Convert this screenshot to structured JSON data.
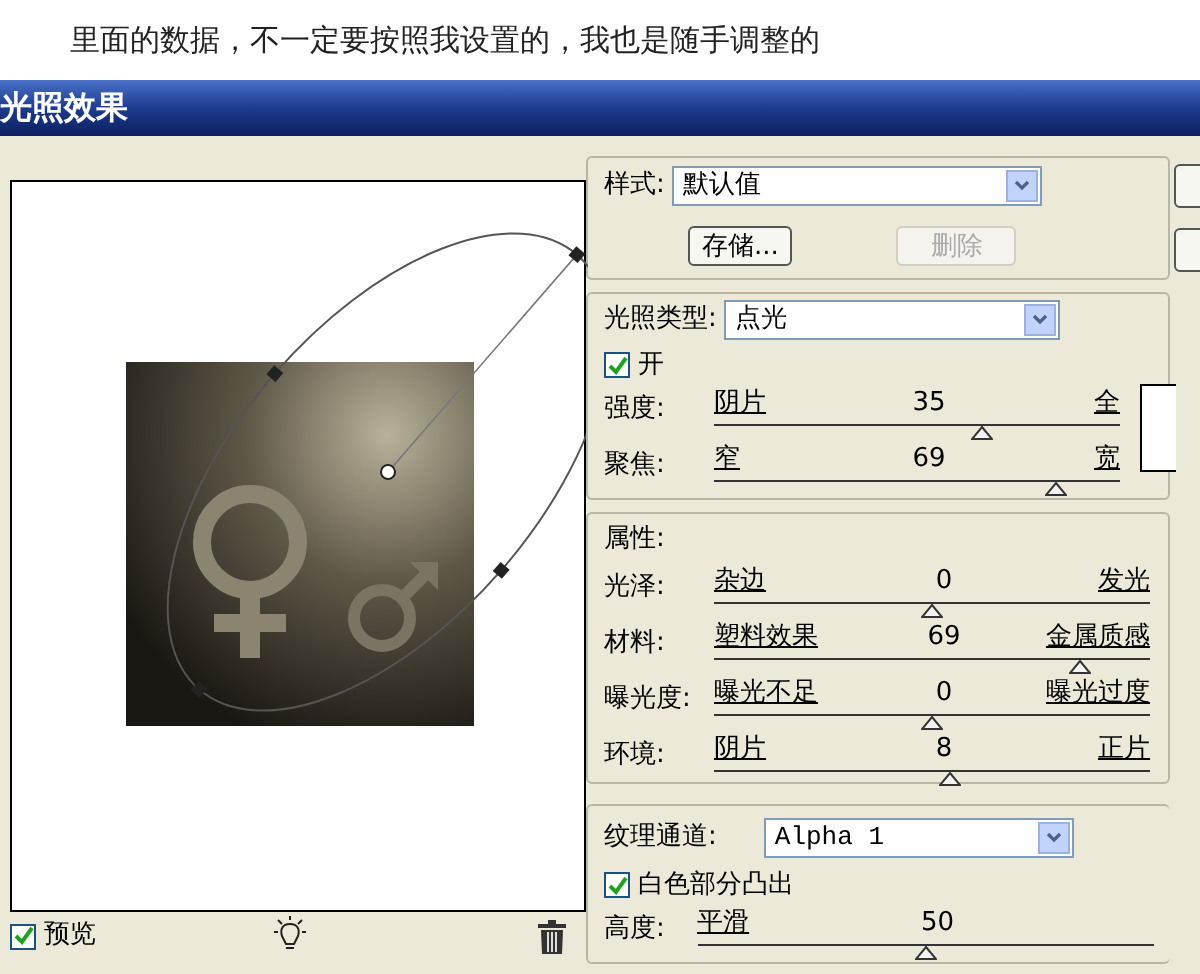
{
  "caption": "里面的数据，不一定要按照我设置的，我也是随手调整的",
  "window": {
    "title": "光照效果"
  },
  "style": {
    "label": "样式:",
    "value": "默认值"
  },
  "buttons": [
    {
      "label": "存储...",
      "disabled": false
    },
    {
      "label": "删除",
      "disabled": true
    }
  ],
  "light_type": {
    "label": "光照类型:",
    "value": "点光"
  },
  "light_on": {
    "label": "开",
    "checked": true
  },
  "light_sliders": [
    {
      "label": "强度:",
      "min": "阴片",
      "value": "35",
      "max": "全",
      "level": 0.66
    },
    {
      "label": "聚焦:",
      "min": "窄",
      "value": "69",
      "max": "宽",
      "level": 0.84
    }
  ],
  "properties": {
    "title": "属性:",
    "sliders": [
      {
        "label": "光泽:",
        "min": "杂边",
        "value": "0",
        "max": "发光",
        "level": 0.5
      },
      {
        "label": "材料:",
        "min": "塑料效果",
        "value": "69",
        "max": "金属质感",
        "level": 0.84
      },
      {
        "label": "曝光度:",
        "min": "曝光不足",
        "value": "0",
        "max": "曝光过度",
        "level": 0.5
      },
      {
        "label": "环境:",
        "min": "阴片",
        "value": "8",
        "max": "正片",
        "level": 0.54
      }
    ]
  },
  "texture": {
    "label": "纹理通道:",
    "value": "Alpha 1",
    "white_high": {
      "label": "白色部分凸出",
      "checked": true
    },
    "sliders": [
      {
        "label": "高度:",
        "min": "平滑",
        "value": "50",
        "level": 0.5
      }
    ]
  },
  "preview": {
    "label": "预览",
    "checked": true
  }
}
